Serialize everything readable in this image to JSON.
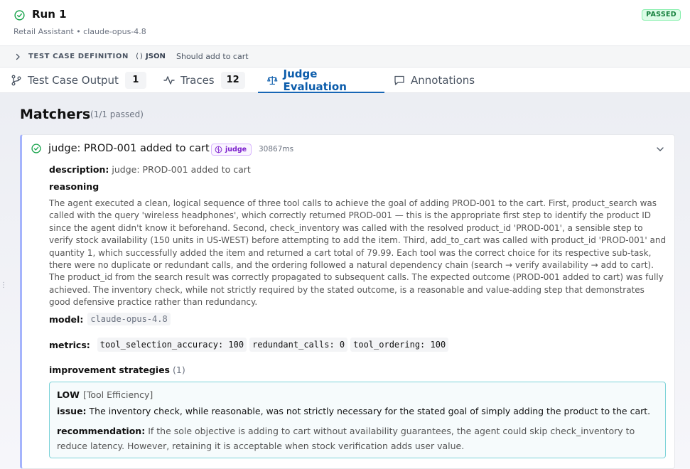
{
  "header": {
    "title": "Run 1",
    "subtitle": "Retail Assistant • claude-opus-4.8",
    "status": "PASSED"
  },
  "test_case": {
    "label": "TEST CASE DEFINITION",
    "json_tag": "JSON",
    "json_prefix": "()",
    "description": "Should add to cart"
  },
  "tabs": [
    {
      "label": "Test Case Output",
      "count": "1"
    },
    {
      "label": "Traces",
      "count": "12"
    },
    {
      "label": "Judge Evaluation",
      "active": true
    },
    {
      "label": "Annotations"
    }
  ],
  "matchers": {
    "title": "Matchers",
    "summary": "(1/1 passed)",
    "items": [
      {
        "title": "judge: PROD-001 added to cart",
        "badge": "judge",
        "duration": "30867ms",
        "description_label": "description:",
        "description": "judge: PROD-001 added to cart",
        "reasoning_label": "reasoning",
        "reasoning": "The agent executed a clean, logical sequence of three tool calls to achieve the goal of adding PROD-001 to the cart. First, product_search was called with the query 'wireless headphones', which correctly returned PROD-001 — this is the appropriate first step to identify the product ID since the agent didn't know it beforehand. Second, check_inventory was called with the resolved product_id 'PROD-001', a sensible step to verify stock availability (150 units in US-WEST) before attempting to add the item. Third, add_to_cart was called with product_id 'PROD-001' and quantity 1, which successfully added the item and returned a cart total of 79.99. Each tool was the correct choice for its respective sub-task, there were no duplicate or redundant calls, and the ordering followed a natural dependency chain (search → verify availability → add to cart). The product_id from the search result was correctly propagated to subsequent calls. The expected outcome (PROD-001 added to cart) was fully achieved. The inventory check, while not strictly required by the stated outcome, is a reasonable and value-adding step that demonstrates good defensive practice rather than redundancy.",
        "model_label": "model:",
        "model": "claude-opus-4.8",
        "metrics_label": "metrics:",
        "metrics": [
          "tool_selection_accuracy: 100",
          "redundant_calls: 0",
          "tool_ordering: 100"
        ],
        "strategies_label": "improvement strategies",
        "strategies_count": "(1)",
        "strategies": [
          {
            "severity": "LOW",
            "category": "[Tool Efficiency]",
            "issue_label": "issue:",
            "issue": "The inventory check, while reasonable, was not strictly necessary for the stated goal of simply adding the product to the cart.",
            "recommendation_label": "recommendation:",
            "recommendation": "If the sole objective is adding to cart without availability guarantees, the agent could skip check_inventory to reduce latency. However, retaining it is acceptable when stock verification adds user value."
          }
        ]
      }
    ]
  },
  "colors": {
    "accent": "#1766b5",
    "success": "#16a34a",
    "judge": "#7e22ce",
    "strategy_border": "#7dd3d8"
  }
}
